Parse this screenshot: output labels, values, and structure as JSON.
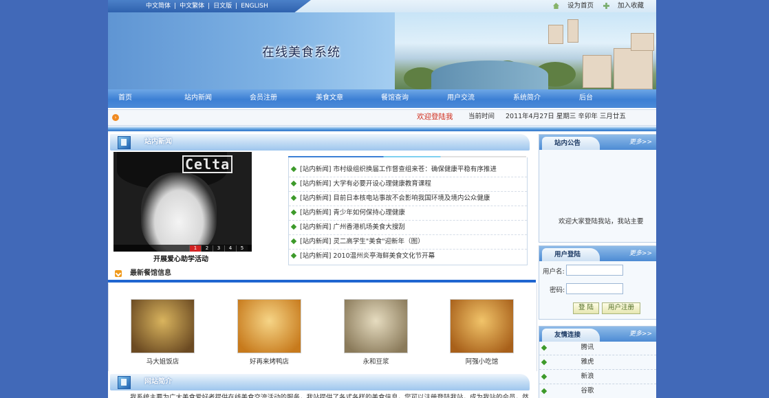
{
  "languages": [
    "中文简体",
    "中文繁体",
    "日文版",
    "ENGLISH"
  ],
  "top_links": {
    "set_home": "设为首页",
    "bookmark": "加入收藏"
  },
  "site_title": "在线美食系统",
  "nav": [
    "首页",
    "站内新闻",
    "会员注册",
    "美食文章",
    "餐馆查询",
    "用户交流",
    "系统简介",
    "后台"
  ],
  "status": {
    "welcome": "欢迎登陆我",
    "time_label": "当前时间",
    "time_value": "2011年4月27日  星期三  辛卯年  三月廿五"
  },
  "news": {
    "title": "站内新闻",
    "slide_logo": "Celta",
    "slide_pages": [
      "1",
      "2",
      "3",
      "4",
      "5"
    ],
    "slide_active_page": "1",
    "slide_caption": "开展爱心助学活动",
    "items": [
      "[站内新闻] 市村级组织换届工作督查组来苍：确保健康平稳有序推进",
      "[站内新闻] 大学有必要开设心理健康教育课程",
      "[站内新闻] 目前日本核电站事故不会影响我国环境及境内公众健康",
      "[站内新闻] 青少年如何保持心理健康",
      "[站内新闻] 广州香港机场美食大搜刮",
      "[站内新闻] 灵二高学生\"美食\"迎新年（图）",
      "[站内新闻] 2010温州炎亭海鲜美食文化节开幕"
    ]
  },
  "restaurants": {
    "title": "最新餐馆信息",
    "items": [
      {
        "name": "马大姐饭店",
        "color_a": "#6b4a22",
        "color_b": "#d9b45e"
      },
      {
        "name": "好再来烤鸭店",
        "color_a": "#c77a1c",
        "color_b": "#f6d587"
      },
      {
        "name": "永和豆浆",
        "color_a": "#8a7a5a",
        "color_b": "#e6dcc0"
      },
      {
        "name": "阿强小吃馆",
        "color_a": "#a8601a",
        "color_b": "#f1c46a"
      }
    ]
  },
  "intro": {
    "title": "网站简介",
    "text": "我系统主要为广大美食爱好者提供在线美食交流活动的服务，我站提供了各式各样的美食信息，您可以注册登陆我站，成为我站的会员，然"
  },
  "notice": {
    "title": "站内公告",
    "more": "更多>>",
    "text": "欢迎大家登陆我站，我站主要"
  },
  "login": {
    "title": "用户登陆",
    "more": "更多>>",
    "username_label": "用户名:",
    "password_label": "密码:",
    "login_button": "登 陆",
    "register_button": "用户注册"
  },
  "links": {
    "title": "友情连接",
    "more": "更多>>",
    "items": [
      "腾讯",
      "雅虎",
      "新浪",
      "谷歌"
    ]
  }
}
